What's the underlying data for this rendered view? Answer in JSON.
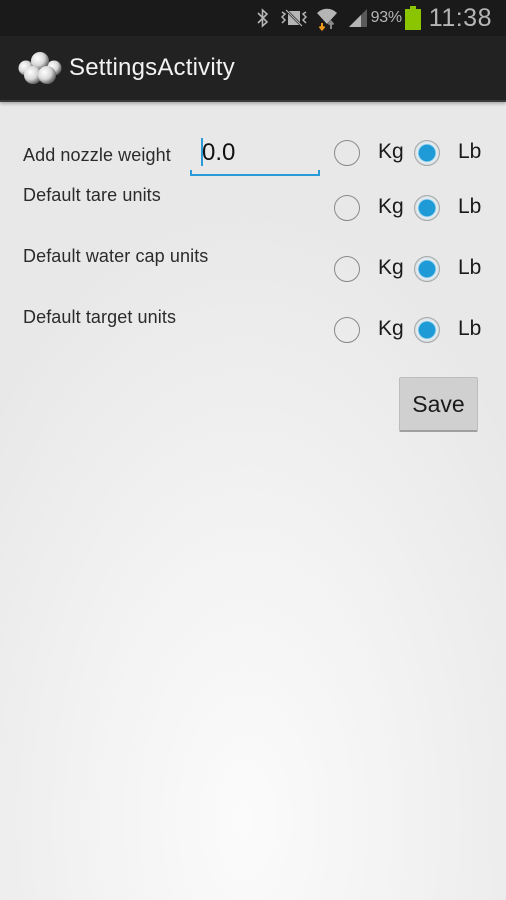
{
  "status_bar": {
    "icons": [
      "bluetooth-icon",
      "vibrate-icon",
      "wifi-icon",
      "signal-icon",
      "battery-icon"
    ],
    "battery_percent": "93%",
    "time": "11:38",
    "battery_color": "#8bc400"
  },
  "action_bar": {
    "title": "SettingsActivity",
    "icon": "app-molecule-icon"
  },
  "settings": {
    "nozzle_weight": {
      "label": "Add nozzle weight",
      "value": "0.0"
    },
    "rows": [
      {
        "label": "Default tare units",
        "options": [
          "Kg",
          "Lb"
        ],
        "selected": "Lb"
      },
      {
        "label": "Default water cap units",
        "options": [
          "Kg",
          "Lb"
        ],
        "selected": "Lb"
      },
      {
        "label": "Default target units",
        "options": [
          "Kg",
          "Lb"
        ],
        "selected": "Lb"
      }
    ],
    "nozzle_units": {
      "options": [
        "Kg",
        "Lb"
      ],
      "selected": "Lb"
    }
  },
  "actions": {
    "save_label": "Save"
  },
  "colors": {
    "accent": "#2a9ad8",
    "radio_fill": "#1e9bd6",
    "action_bar_bg": "#222222",
    "status_bar_bg": "#1a1a1a"
  }
}
